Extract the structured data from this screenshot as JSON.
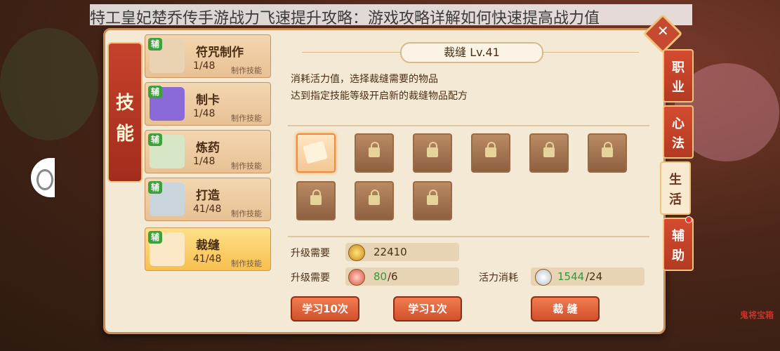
{
  "banner": {
    "text": "特工皇妃楚乔传手游战力飞速提升攻略：游戏攻略详解如何快速提高战力值"
  },
  "skill_ribbon": {
    "chars": [
      "技",
      "能"
    ]
  },
  "skills": [
    {
      "badge": "辅",
      "name": "符咒制作",
      "count": "1/48",
      "tag": "制作技能",
      "icon": "talisman-icon",
      "active": false
    },
    {
      "badge": "辅",
      "name": "制卡",
      "count": "1/48",
      "tag": "制作技能",
      "icon": "card-icon",
      "active": false
    },
    {
      "badge": "辅",
      "name": "炼药",
      "count": "1/48",
      "tag": "制作技能",
      "icon": "herb-icon",
      "active": false
    },
    {
      "badge": "辅",
      "name": "打造",
      "count": "41/48",
      "tag": "制作技能",
      "icon": "hammer-icon",
      "active": false
    },
    {
      "badge": "辅",
      "name": "裁缝",
      "count": "41/48",
      "tag": "制作技能",
      "icon": "tailor-scroll-icon",
      "active": true
    }
  ],
  "content": {
    "title": "裁缝 Lv.41",
    "desc1": "消耗活力值，选择裁缝需要的物品",
    "desc2": "达到指定技能等级开启新的裁缝物品配方",
    "items_row1": [
      "unlocked",
      "locked",
      "locked",
      "locked",
      "locked",
      "locked"
    ],
    "items_row2": [
      "locked",
      "locked",
      "locked"
    ],
    "upgrade_label_1": "升级需要",
    "upgrade_value_1": "22410",
    "upgrade_label_2": "升级需要",
    "upgrade_have_2": "80",
    "upgrade_need_2": "/6",
    "vitality_label": "活力消耗",
    "vitality_have": "1544",
    "vitality_need": "/24",
    "btn_learn10": "学习10次",
    "btn_learn1": "学习1次",
    "btn_tailor": "裁 缝"
  },
  "right_tabs": [
    {
      "chars": [
        "职",
        "业"
      ],
      "active": false
    },
    {
      "chars": [
        "心",
        "法"
      ],
      "active": false
    },
    {
      "chars": [
        "生",
        "活"
      ],
      "active": true
    },
    {
      "chars": [
        "辅",
        "助"
      ],
      "active": false
    }
  ],
  "close_label": "✕",
  "right_badge": "鬼将宝箱",
  "colors": {
    "accent_red": "#c64a2f",
    "panel_bg": "#f4e9d4",
    "green_value": "#2e9a3c"
  }
}
